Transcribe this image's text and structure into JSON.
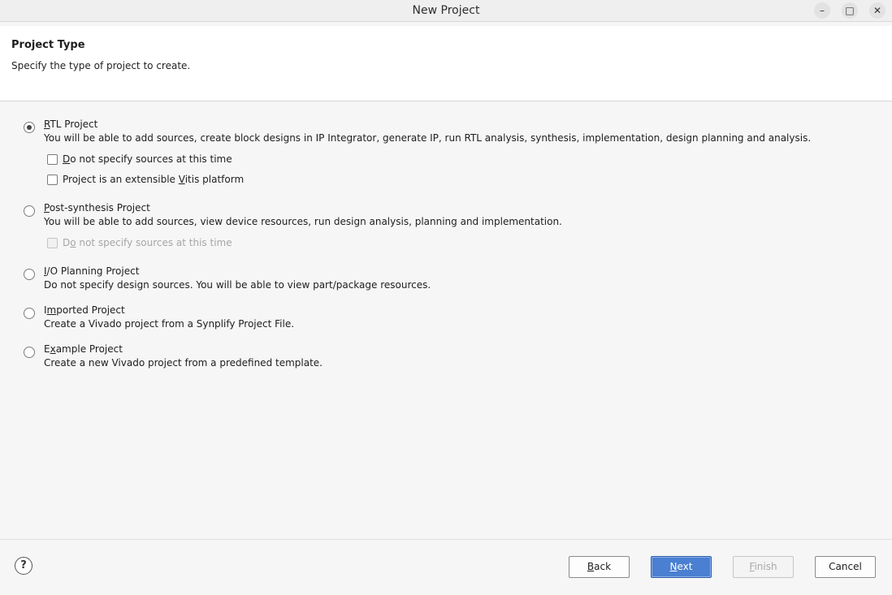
{
  "window": {
    "title": "New Project",
    "minimize_glyph": "–",
    "maximize_glyph": "□",
    "close_glyph": "✕"
  },
  "header": {
    "title": "Project Type",
    "subtitle": "Specify the type of project to create."
  },
  "options": [
    {
      "label": "RTL Project",
      "mnemonic": "R",
      "description": "You will be able to add sources, create block designs in IP Integrator, generate IP, run RTL analysis, synthesis, implementation, design planning and analysis.",
      "selected": true,
      "checkboxes": [
        {
          "label": "Do not specify sources at this time",
          "mnemonic": "D",
          "checked": false,
          "enabled": true
        },
        {
          "label": "Project is an extensible Vitis platform",
          "mnemonic": "V",
          "checked": false,
          "enabled": true
        }
      ]
    },
    {
      "label": "Post-synthesis Project",
      "mnemonic": "P",
      "description": "You will be able to add sources, view device resources, run design analysis, planning and implementation.",
      "selected": false,
      "checkboxes": [
        {
          "label": "Do not specify sources at this time",
          "mnemonic": "o",
          "checked": false,
          "enabled": false
        }
      ]
    },
    {
      "label": "I/O Planning Project",
      "mnemonic": "I",
      "description": "Do not specify design sources. You will be able to view part/package resources.",
      "selected": false,
      "checkboxes": []
    },
    {
      "label": "Imported Project",
      "mnemonic": "m",
      "description": "Create a Vivado project from a Synplify Project File.",
      "selected": false,
      "checkboxes": []
    },
    {
      "label": "Example Project",
      "mnemonic": "x",
      "description": "Create a new Vivado project from a predefined template.",
      "selected": false,
      "checkboxes": []
    }
  ],
  "footer": {
    "help_glyph": "?",
    "back_label": "Back",
    "next_label": "Next",
    "finish_label": "Finish",
    "cancel_label": "Cancel"
  }
}
